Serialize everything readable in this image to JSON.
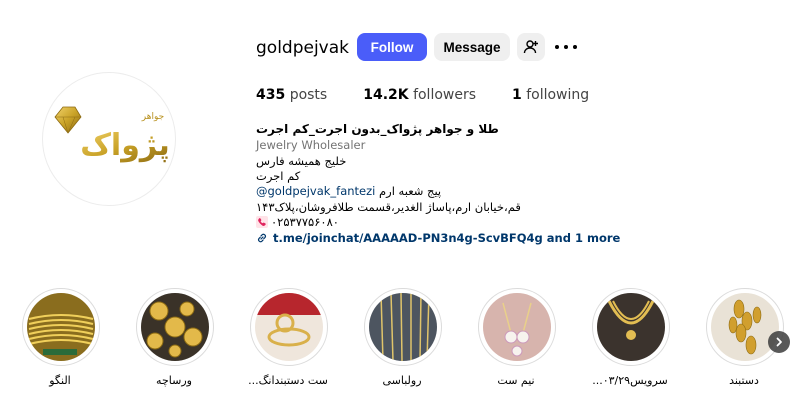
{
  "profile": {
    "username": "goldpejvak",
    "avatar_icon": "pejvak-gold-logo",
    "avatar_logo_text": "پژواک",
    "avatar_logo_subtext": "جواهر",
    "follow_label": "Follow",
    "message_label": "Message",
    "add_user_icon": "add-user-icon",
    "more_icon": "more-options-icon"
  },
  "stats": {
    "posts_count": "435",
    "posts_label": "posts",
    "followers_count": "14.2K",
    "followers_label": "followers",
    "following_count": "1",
    "following_label": "following"
  },
  "bio": {
    "name": "طلا و جواهر پژواک_بدون اجرت_کم اجرت",
    "category": "Jewelry Wholesaler",
    "line1": "خلیج همیشه فارس",
    "line2": "کم اجرت",
    "mention": "@goldpejvak_fantezi",
    "mention_suffix": "پیج شعبه ارم",
    "address": "قم،خیابان ارم،پاساژ الغدیر،قسمت طلافروشان،پلاک۱۴۳",
    "phone_icon": "phone-icon",
    "phone": "۰۲۵۳۷۷۵۶۰۸۰",
    "link_icon": "link-icon",
    "link": "t.me/joinchat/AAAAAD-PN3n4g-ScvBFQ4g and 1 more"
  },
  "highlights": [
    {
      "label": "النگو"
    },
    {
      "label": "ورساچه"
    },
    {
      "label": "ست دستبندانگ..."
    },
    {
      "label": "رولباسی"
    },
    {
      "label": "نیم ست"
    },
    {
      "label": "سرویس۰۳/۲۹..."
    },
    {
      "label": "دستبند"
    }
  ],
  "highlights_next_icon": "chevron-right-icon",
  "colors": {
    "accent": "#4a5df9",
    "link": "#00376b",
    "gold": "#c9a227"
  }
}
